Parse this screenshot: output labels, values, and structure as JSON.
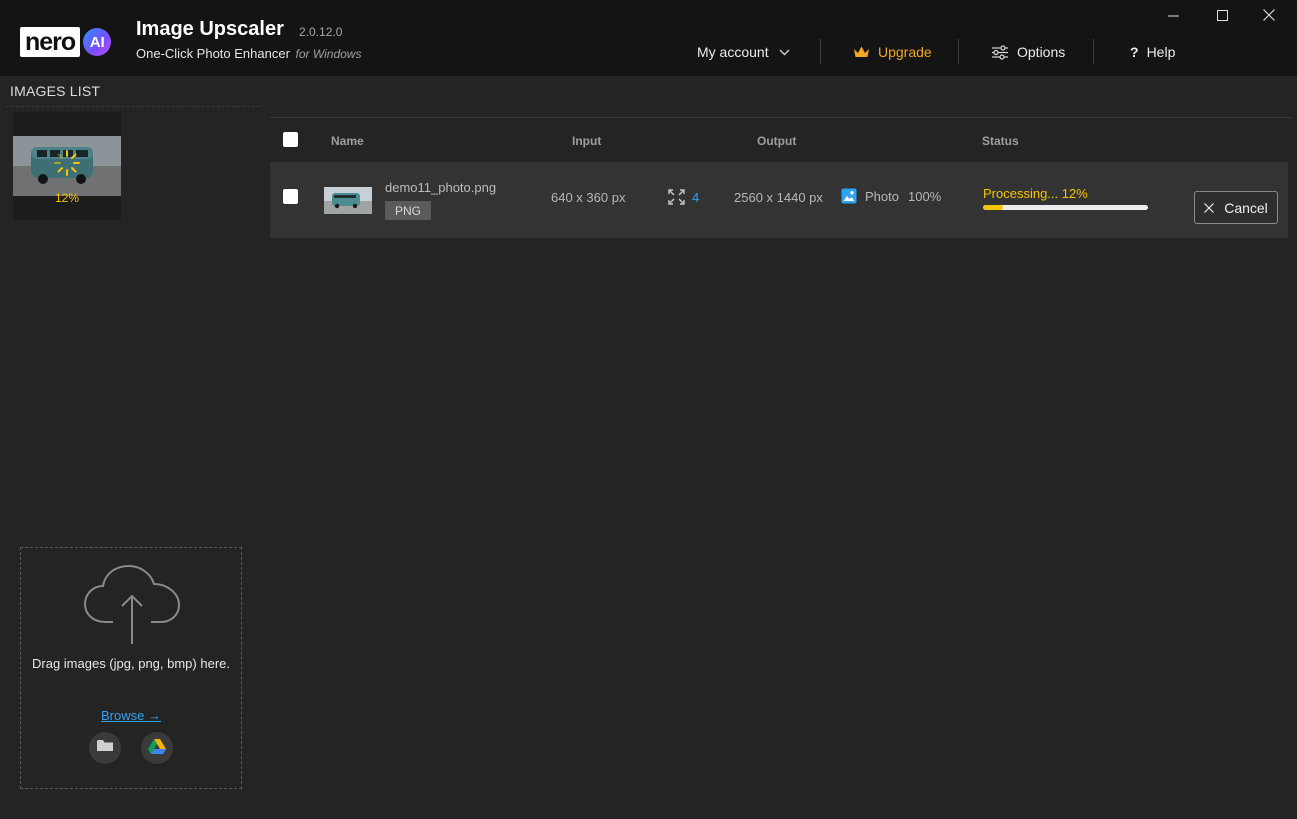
{
  "app": {
    "brand_nero": "nero",
    "brand_ai": "AI",
    "title": "Image Upscaler",
    "version": "2.0.12.0",
    "subtitle": "One-Click Photo Enhancer",
    "subtitle_os": "for Windows"
  },
  "nav": {
    "account": "My account",
    "upgrade": "Upgrade",
    "options": "Options",
    "help": "Help"
  },
  "sidebar": {
    "title": "IMAGES LIST",
    "items": [
      {
        "progress_label": "12%"
      }
    ]
  },
  "dropzone": {
    "text": "Drag images (jpg, png, bmp) here.",
    "browse": "Browse →"
  },
  "table": {
    "columns": {
      "name": "Name",
      "input": "Input",
      "output": "Output",
      "status": "Status"
    },
    "rows": [
      {
        "name": "demo11_photo.png",
        "format": "PNG",
        "input": "640 x 360 px",
        "scale": "4",
        "output": "2560 x 1440 px",
        "model": "Photo",
        "strength": "100%",
        "status": "Processing... 12%",
        "progress": 0.12,
        "cancel": "Cancel"
      }
    ]
  },
  "colors": {
    "accent_blue": "#2ea3f2",
    "upgrade_orange": "#f5a623",
    "progress_yellow": "#f5c400",
    "background": "#242424",
    "titlebar": "#141414",
    "row": "#333333"
  },
  "icons": {
    "chevron": "chevron-down-icon",
    "upgrade": "crown-icon",
    "options": "sliders-icon",
    "help": "question-icon",
    "scale": "expand-icon",
    "model": "photo-icon",
    "cancel": "close-icon",
    "folder": "folder-icon",
    "drive": "google-drive-icon",
    "upload": "cloud-upload-icon"
  }
}
